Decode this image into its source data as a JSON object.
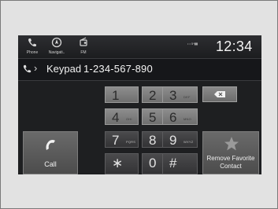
{
  "apps": [
    {
      "label": "Phone",
      "icon": "phone-icon"
    },
    {
      "label": "Navigati..",
      "icon": "navigation-icon"
    },
    {
      "label": "FM",
      "icon": "radio-icon"
    }
  ],
  "status": {
    "indicators": "• • 5ⁿ▮▮",
    "time": "12:34"
  },
  "header": {
    "title": "Keypad",
    "number": "1-234-567-890"
  },
  "keys": [
    {
      "digit": "1",
      "letters": ""
    },
    {
      "digit": "2",
      "letters": "ABC"
    },
    {
      "digit": "3",
      "letters": "DEF"
    },
    {
      "digit": "4",
      "letters": "GHI"
    },
    {
      "digit": "5",
      "letters": "JKL"
    },
    {
      "digit": "6",
      "letters": "MNO"
    },
    {
      "digit": "7",
      "letters": "PQRS"
    },
    {
      "digit": "8",
      "letters": "TUV"
    },
    {
      "digit": "9",
      "letters": "WXYZ"
    },
    {
      "digit": "∗",
      "letters": ""
    },
    {
      "digit": "0",
      "letters": "+"
    },
    {
      "digit": "#",
      "letters": ""
    }
  ],
  "buttons": {
    "call": "Call",
    "favorite_line1": "Remove Favorite",
    "favorite_line2": "Contact"
  }
}
